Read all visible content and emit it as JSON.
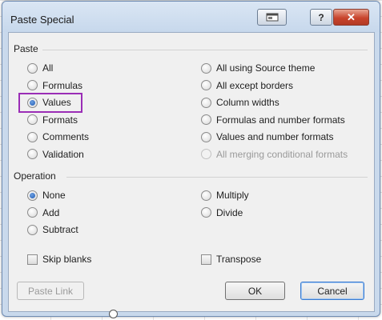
{
  "dialog": {
    "title": "Paste Special",
    "help_label": "?",
    "close_label": "✕"
  },
  "paste": {
    "label": "Paste",
    "left_options": [
      {
        "label": "All",
        "checked": false,
        "disabled": false
      },
      {
        "label": "Formulas",
        "checked": false,
        "disabled": false
      },
      {
        "label": "Values",
        "checked": true,
        "disabled": false
      },
      {
        "label": "Formats",
        "checked": false,
        "disabled": false
      },
      {
        "label": "Comments",
        "checked": false,
        "disabled": false
      },
      {
        "label": "Validation",
        "checked": false,
        "disabled": false
      }
    ],
    "right_options": [
      {
        "label": "All using Source theme",
        "checked": false,
        "disabled": false
      },
      {
        "label": "All except borders",
        "checked": false,
        "disabled": false
      },
      {
        "label": "Column widths",
        "checked": false,
        "disabled": false
      },
      {
        "label": "Formulas and number formats",
        "checked": false,
        "disabled": false
      },
      {
        "label": "Values and number formats",
        "checked": false,
        "disabled": false
      },
      {
        "label": "All merging conditional formats",
        "checked": false,
        "disabled": true
      }
    ]
  },
  "operation": {
    "label": "Operation",
    "left_options": [
      {
        "label": "None",
        "checked": true
      },
      {
        "label": "Add",
        "checked": false
      },
      {
        "label": "Subtract",
        "checked": false
      }
    ],
    "right_options": [
      {
        "label": "Multiply",
        "checked": false
      },
      {
        "label": "Divide",
        "checked": false
      }
    ]
  },
  "checkboxes": {
    "skip_blanks": "Skip blanks",
    "transpose": "Transpose"
  },
  "buttons": {
    "paste_link": "Paste Link",
    "ok": "OK",
    "cancel": "Cancel"
  },
  "colors": {
    "highlight": "#9a2db6",
    "close_button": "#c8442c",
    "frame": "#c9d9ec"
  }
}
